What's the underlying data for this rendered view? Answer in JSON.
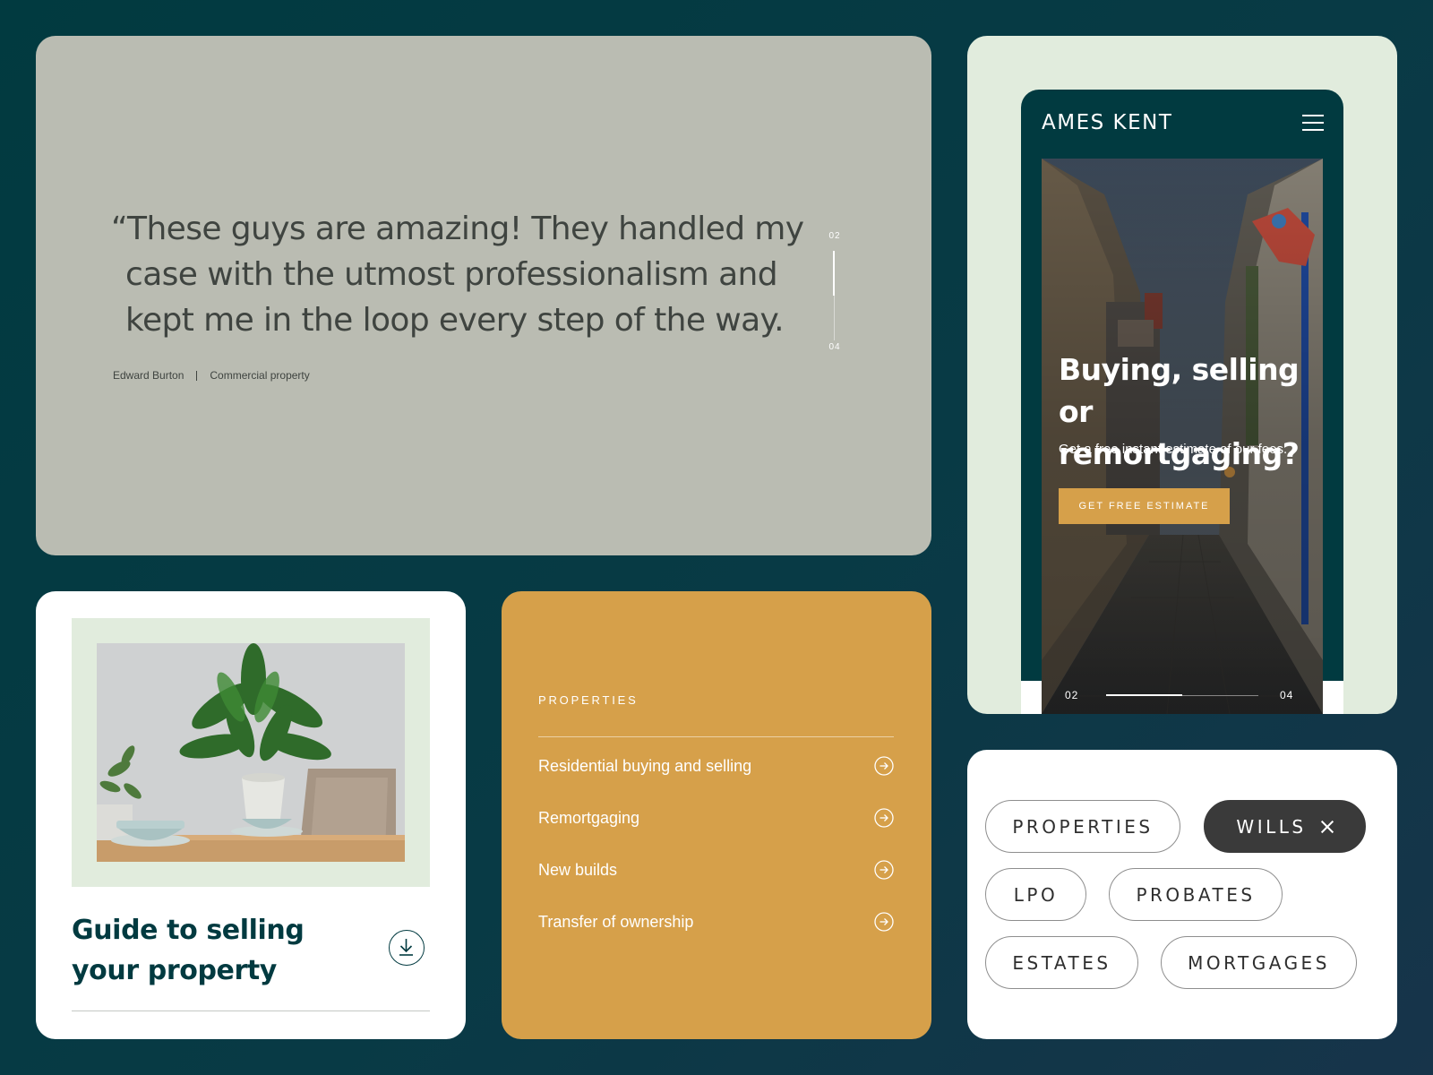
{
  "testimonial": {
    "quote": "“These guys are amazing! They handled my case with the utmost professionalism and kept me in the loop every step of the way.",
    "author": "Edward Burton",
    "category": "Commercial property",
    "pager": {
      "current": "02",
      "total": "04",
      "progress": 0.5
    }
  },
  "mobile": {
    "logo": "AMES KENT",
    "menu_icon": "hamburger-icon",
    "headline": "Buying, selling or remortgaging?",
    "subtext": "Get a free instant estimate of our fees.",
    "cta_label": "GET FREE ESTIMATE",
    "pager": {
      "current": "02",
      "total": "04",
      "progress": 0.5
    }
  },
  "guide": {
    "title": "Guide to selling your property",
    "icon": "download-icon"
  },
  "properties": {
    "eyebrow": "PROPERTIES",
    "items": [
      {
        "label": "Residential buying and selling"
      },
      {
        "label": "Remortgaging"
      },
      {
        "label": "New builds"
      },
      {
        "label": "Transfer of ownership"
      }
    ],
    "item_icon": "arrow-right-circle-icon"
  },
  "tags": {
    "items": [
      {
        "label": "PROPERTIES",
        "active": false
      },
      {
        "label": "WILLS",
        "active": true
      },
      {
        "label": "LPO",
        "active": false
      },
      {
        "label": "PROBATES",
        "active": false
      },
      {
        "label": "ESTATES",
        "active": false
      },
      {
        "label": "MORTGAGES",
        "active": false
      }
    ],
    "remove_icon": "close-icon"
  },
  "colors": {
    "background": "#013a40",
    "accent_gold": "#d6a04a",
    "mint": "#e1ecdd",
    "testimonial_bg": "#babcb2",
    "tag_active": "#3a3a3a"
  }
}
